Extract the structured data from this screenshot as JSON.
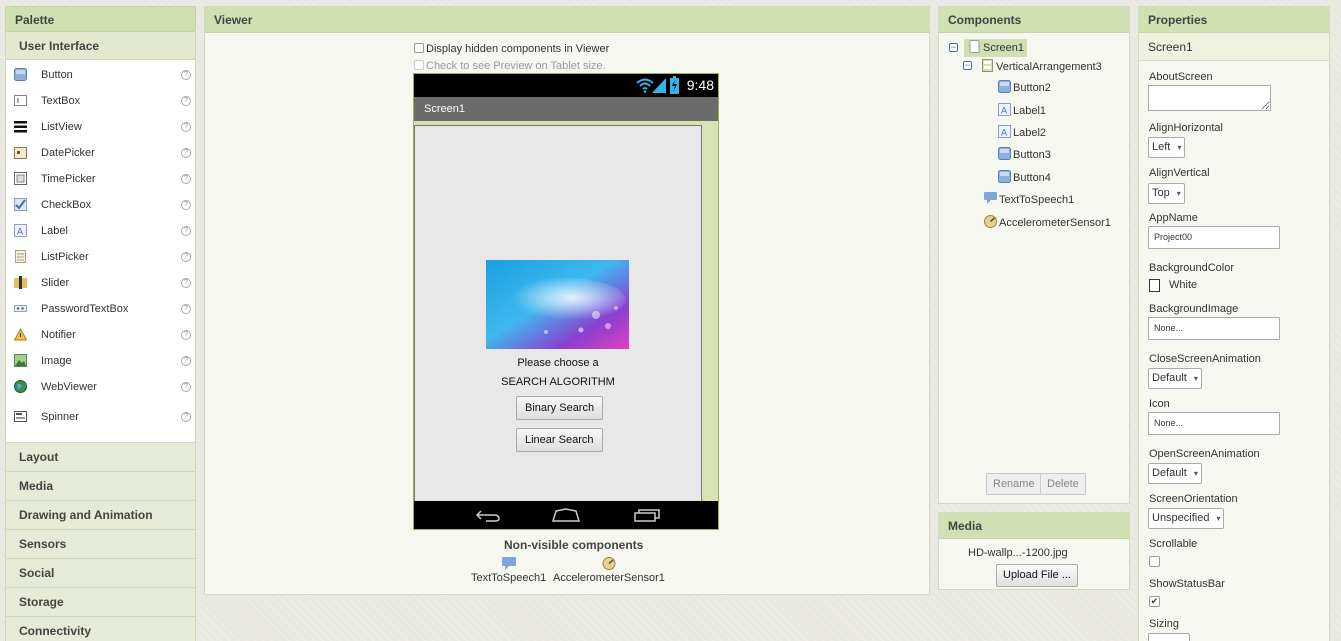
{
  "palette": {
    "title": "Palette",
    "category_open": "User Interface",
    "items": [
      {
        "label": "Button",
        "icon": "button-icon"
      },
      {
        "label": "TextBox",
        "icon": "textbox-icon"
      },
      {
        "label": "ListView",
        "icon": "listview-icon"
      },
      {
        "label": "DatePicker",
        "icon": "datepicker-icon"
      },
      {
        "label": "TimePicker",
        "icon": "timepicker-icon"
      },
      {
        "label": "CheckBox",
        "icon": "checkbox-icon"
      },
      {
        "label": "Label",
        "icon": "label-icon"
      },
      {
        "label": "ListPicker",
        "icon": "listpicker-icon"
      },
      {
        "label": "Slider",
        "icon": "slider-icon"
      },
      {
        "label": "PasswordTextBox",
        "icon": "passwordtextbox-icon"
      },
      {
        "label": "Notifier",
        "icon": "notifier-icon"
      },
      {
        "label": "Image",
        "icon": "image-icon"
      },
      {
        "label": "WebViewer",
        "icon": "webviewer-icon"
      },
      {
        "label": "Spinner",
        "icon": "spinner-icon"
      }
    ],
    "help_glyph": "?",
    "categories": [
      "Layout",
      "Media",
      "Drawing and Animation",
      "Sensors",
      "Social",
      "Storage",
      "Connectivity"
    ]
  },
  "viewer": {
    "title": "Viewer",
    "display_hidden": "Display hidden components in Viewer",
    "tablet_preview": "Check to see Preview on Tablet size.",
    "status_time": "9:48",
    "screen_title": "Screen1",
    "label1": "Please choose a",
    "label2": "SEARCH ALGORITHM",
    "button1": "Binary Search",
    "button2": "Linear Search",
    "nonvisible_title": "Non-visible components",
    "nonvisible": [
      "TextToSpeech1",
      "AccelerometerSensor1"
    ]
  },
  "components": {
    "title": "Components",
    "tree": {
      "screen": "Screen1",
      "arrangement": "VerticalArrangement3",
      "children": [
        "Button2",
        "Label1",
        "Label2",
        "Button3",
        "Button4"
      ],
      "others": [
        "TextToSpeech1",
        "AccelerometerSensor1"
      ]
    },
    "rename": "Rename",
    "delete": "Delete",
    "toggle_glyph": "−"
  },
  "media": {
    "title": "Media",
    "file": "HD-wallp...-1200.jpg",
    "upload": "Upload File ..."
  },
  "properties": {
    "title": "Properties",
    "component": "Screen1",
    "about_screen": {
      "label": "AboutScreen",
      "value": ""
    },
    "align_horizontal": {
      "label": "AlignHorizontal",
      "value": "Left"
    },
    "align_vertical": {
      "label": "AlignVertical",
      "value": "Top"
    },
    "app_name": {
      "label": "AppName",
      "value": "Project00"
    },
    "background_color": {
      "label": "BackgroundColor",
      "value": "White"
    },
    "background_image": {
      "label": "BackgroundImage",
      "value": "None..."
    },
    "close_anim": {
      "label": "CloseScreenAnimation",
      "value": "Default"
    },
    "icon": {
      "label": "Icon",
      "value": "None..."
    },
    "open_anim": {
      "label": "OpenScreenAnimation",
      "value": "Default"
    },
    "orientation": {
      "label": "ScreenOrientation",
      "value": "Unspecified"
    },
    "scrollable": {
      "label": "Scrollable",
      "checked": false
    },
    "show_status_bar": {
      "label": "ShowStatusBar",
      "checked": true,
      "glyph": "✔"
    },
    "sizing": {
      "label": "Sizing"
    }
  },
  "colors": {
    "panel_header": "#d1e0b3",
    "phone_border": "#9ab64a",
    "selected": "#d1e0b3"
  }
}
